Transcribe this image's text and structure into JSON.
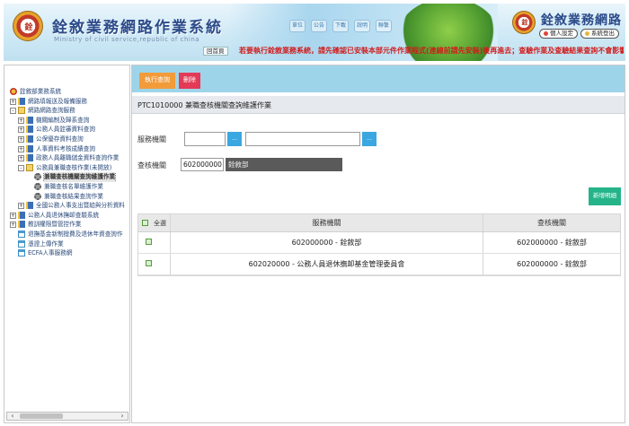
{
  "header": {
    "system_title": "銓敘業務網路作業系統",
    "system_subtitle": "Ministry of civil service,republic of china",
    "logo_text": "銓",
    "nav_icons": [
      "單位",
      "公告",
      "下載",
      "說明",
      "聯繫"
    ],
    "right_title": "銓敘業務網路",
    "home_link": "回首頁",
    "personal_settings": "個人設定",
    "logout": "系統登出",
    "marquee": "若要執行銓敘業務系統，請先確認已安裝本部元件作業程式(連線前請先安裝)後再進去；查驗作業及查驗結果查詢不會影響..."
  },
  "sidebar": {
    "items": [
      {
        "label": "銓敘部業務系統",
        "level": 0,
        "icon": "root-icon",
        "expander": ""
      },
      {
        "label": "網路填報送及報備服務",
        "level": 1,
        "icon": "book-icon",
        "expander": "+"
      },
      {
        "label": "網路網路查詢服務",
        "level": 1,
        "icon": "book-open-icon",
        "expander": "-"
      },
      {
        "label": "機關編制及歸系查詢",
        "level": 2,
        "icon": "book-icon",
        "expander": "+"
      },
      {
        "label": "公務人員銓審資料查詢",
        "level": 2,
        "icon": "book-icon",
        "expander": "+"
      },
      {
        "label": "公保優存資料查詢",
        "level": 2,
        "icon": "book-icon",
        "expander": "+"
      },
      {
        "label": "人事資料考核成績查詢",
        "level": 2,
        "icon": "book-icon",
        "expander": "+"
      },
      {
        "label": "政務人員離職儲金資料查詢作業",
        "level": 2,
        "icon": "book-icon",
        "expander": "+"
      },
      {
        "label": "公務員兼職查核作業(未開放)",
        "level": 2,
        "icon": "book-open-icon",
        "expander": "-"
      },
      {
        "label": "兼職查核機關查詢維護作業",
        "level": 3,
        "icon": "gear-icon",
        "expander": "",
        "selected": true
      },
      {
        "label": "兼職查核名單維護作業",
        "level": 3,
        "icon": "gear-icon",
        "expander": ""
      },
      {
        "label": "兼職查核結果查詢作業",
        "level": 3,
        "icon": "gear-icon",
        "expander": ""
      },
      {
        "label": "全國公務人事支出暨給與分析資料",
        "level": 2,
        "icon": "book-icon",
        "expander": "+"
      },
      {
        "label": "公務人員退休撫卹查驗系統",
        "level": 1,
        "icon": "book-icon",
        "expander": "+"
      },
      {
        "label": "教訓權限暨管控作業",
        "level": 1,
        "icon": "book-icon",
        "expander": "+"
      },
      {
        "label": "退撫基金新制撥費及退休年資查詢作",
        "level": 1,
        "icon": "doc-icon",
        "expander": ""
      },
      {
        "label": "憑證上傳作業",
        "level": 1,
        "icon": "doc-icon",
        "expander": ""
      },
      {
        "label": "ECFA人事服務網",
        "level": 1,
        "icon": "doc-icon",
        "expander": ""
      }
    ],
    "scroll_left": "‹",
    "scroll_right": "›"
  },
  "main": {
    "toolbar": {
      "query_label": "執行查詢",
      "delete_label": "刪除"
    },
    "page_title": "PTC1010000 兼職查核機關查詢維護作業",
    "form": {
      "service_org_label": "服務機關",
      "service_org_code": "",
      "service_org_name": "",
      "lookup_label": "...",
      "check_org_label": "查核機關",
      "check_org_code": "602000000",
      "check_org_name": "銓敘部"
    },
    "add_button_label": "新增明細",
    "grid": {
      "select_all_label": "全選",
      "columns": [
        "服務機關",
        "查核機關"
      ],
      "rows": [
        {
          "service_org": "602000000 - 銓敘部",
          "check_org": "602000000 - 銓敘部"
        },
        {
          "service_org": "602020000 - 公務人員退休撫卹基金管理委員會",
          "check_org": "602000000 - 銓敘部"
        }
      ]
    }
  },
  "colors": {
    "toolbar_bg": "#9ed4ea",
    "query_btn": "#f29b3a",
    "delete_btn": "#e23a57",
    "add_btn": "#25b48a",
    "lookup_btn": "#3aa7e0",
    "marquee_text": "#d21b1b"
  }
}
